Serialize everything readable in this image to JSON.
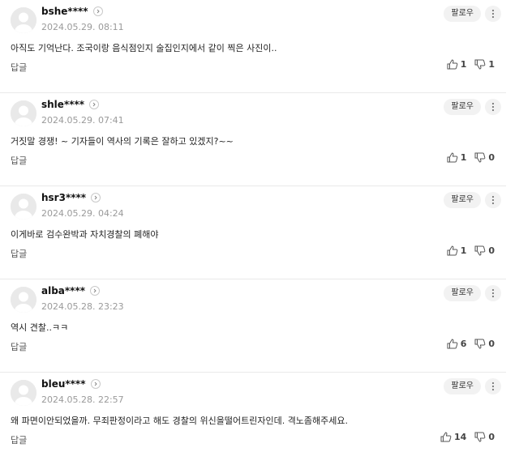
{
  "comments": [
    {
      "username": "bshe****",
      "timestamp": "2024.05.29. 08:11",
      "text": "아직도 기억난다. 조국이랑 음식점인지 술집인지에서 같이 찍은 사진이..",
      "reply_label": "답글",
      "follow_label": "팔로우",
      "likes": "1",
      "dislikes": "1"
    },
    {
      "username": "shle****",
      "timestamp": "2024.05.29. 07:41",
      "text": "거짓말 경쟁! ~ 기자들이 역사의 기록은 잘하고 있겠지?~~",
      "reply_label": "답글",
      "follow_label": "팔로우",
      "likes": "1",
      "dislikes": "0"
    },
    {
      "username": "hsr3****",
      "timestamp": "2024.05.29. 04:24",
      "text": "이게바로 검수완박과 자치경찰의 폐해야",
      "reply_label": "답글",
      "follow_label": "팔로우",
      "likes": "1",
      "dislikes": "0"
    },
    {
      "username": "alba****",
      "timestamp": "2024.05.28. 23:23",
      "text": "역시 견찰..ㅋㅋ",
      "reply_label": "답글",
      "follow_label": "팔로우",
      "likes": "6",
      "dislikes": "0"
    },
    {
      "username": "bleu****",
      "timestamp": "2024.05.28. 22:57",
      "text": "왜 파면이안되었을까. 무죄판정이라고 해도 경찰의 위신을떨어트린자인데. 격노좀해주세요.",
      "reply_label": "답글",
      "follow_label": "팔로우",
      "likes": "14",
      "dislikes": "0"
    }
  ],
  "icons": {
    "avatar": "default-avatar-icon",
    "profile_arrow": "chevron-right-icon",
    "more": "more-options-icon",
    "like": "thumbs-up-icon",
    "dislike": "thumbs-down-icon"
  },
  "colors": {
    "avatar_bg": "#e9e9e9",
    "avatar_figure": "#ffffff",
    "pill_bg": "#f2f2f2",
    "muted_text": "#9a9a9a"
  }
}
